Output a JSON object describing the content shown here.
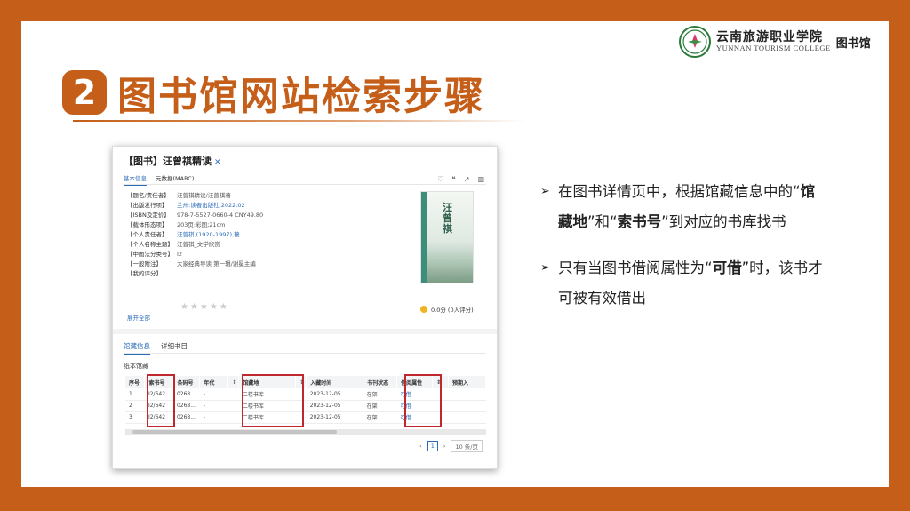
{
  "logo": {
    "name_cn": "云南旅游职业学院",
    "name_en": "YUNNAN TOURISM COLLEGE",
    "library": "图书馆"
  },
  "title": {
    "number": "2",
    "text": "图书馆网站检索步骤"
  },
  "screenshot": {
    "book_title": "【图书】汪曾祺精读",
    "tabs": [
      "基本信息",
      "元数据(MARC)"
    ],
    "meta": [
      {
        "key": "【题名/责任者】",
        "value": "汪曾祺精读/汪曾祺著"
      },
      {
        "key": "【出版发行项】",
        "value": "兰州:读者出版社,2022.02"
      },
      {
        "key": "【ISBN及定价】",
        "value": "978-7-5527-0660-4 CNY49.80"
      },
      {
        "key": "【载体形态项】",
        "value": "203页:彩图;21cm"
      },
      {
        "key": "【个人责任者】",
        "value": "汪曾祺,(1920-1997),著"
      },
      {
        "key": "【个人名称主题】",
        "value": "汪曾祺_文学欣赏"
      },
      {
        "key": "【中图法分类号】",
        "value": "I2"
      },
      {
        "key": "【一般附注】",
        "value": "大家经典导读 第一辑/谢冕主编"
      },
      {
        "key": "【我的评分】",
        "value": ""
      }
    ],
    "expand_label": "展开全部",
    "cover_title": "汪曾祺",
    "rating_text": "0.0分 (0人评分)",
    "holding_tabs": [
      "馆藏信息",
      "详细书目"
    ],
    "paper_label": "纸本馆藏",
    "table_headers": [
      "序号",
      "索书号",
      "条码号",
      "年代",
      "",
      "馆藏地",
      "",
      "入藏时间",
      "书刊状态",
      "借阅属性",
      "",
      "预期入"
    ],
    "rows": [
      [
        "1",
        "I2/642",
        "0268...",
        "-",
        "",
        "二楼书库",
        "",
        "2023-12-05",
        "在架",
        "可借",
        "",
        ""
      ],
      [
        "2",
        "I2/642",
        "0268...",
        "-",
        "",
        "二楼书库",
        "",
        "2023-12-05",
        "在架",
        "可借",
        "",
        ""
      ],
      [
        "3",
        "I2/642",
        "0268...",
        "-",
        "",
        "二楼书库",
        "",
        "2023-12-05",
        "在架",
        "可借",
        "",
        ""
      ]
    ],
    "pager": {
      "page": "1",
      "page_size": "10 条/页"
    }
  },
  "bullets": [
    {
      "pre": "在图书详情页中，根据馆藏信息中的“",
      "b1": "馆藏地",
      "mid": "”和“",
      "b2": "索书号",
      "post": "”到对应的书库找书"
    },
    {
      "pre": "只有当图书借阅属性为“",
      "b1": "可借",
      "post": "”时，该书才可被有效借出"
    }
  ],
  "colors": {
    "accent": "#c45e19",
    "highlight": "#c0262d",
    "link": "#2a6bb8"
  }
}
